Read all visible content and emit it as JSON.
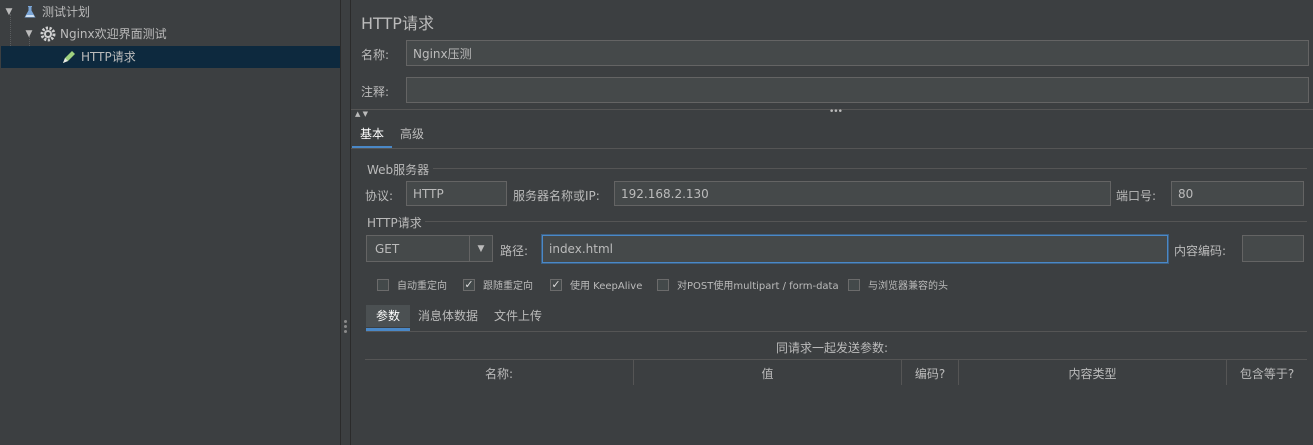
{
  "tree": {
    "items": [
      {
        "label": "测试计划",
        "icon": "flask-icon"
      },
      {
        "label": "Nginx欢迎界面测试",
        "icon": "gear-icon"
      },
      {
        "label": "HTTP请求",
        "icon": "pen-icon"
      }
    ]
  },
  "panel": {
    "title": "HTTP请求",
    "name_label": "名称:",
    "name_value": "Nginx压测",
    "comment_label": "注释:",
    "comment_value": "",
    "tabs": [
      "基本",
      "高级"
    ],
    "web_server": {
      "title": "Web服务器",
      "protocol_label": "协议:",
      "protocol_value": "HTTP",
      "server_label": "服务器名称或IP:",
      "server_value": "192.168.2.130",
      "port_label": "端口号:",
      "port_value": "80"
    },
    "http_request": {
      "title": "HTTP请求",
      "method": "GET",
      "path_label": "路径:",
      "path_value": "index.html",
      "encoding_label": "内容编码:",
      "encoding_value": ""
    },
    "checkboxes": [
      {
        "label": "自动重定向",
        "checked": false
      },
      {
        "label": "跟随重定向",
        "checked": true
      },
      {
        "label": "使用 KeepAlive",
        "checked": true
      },
      {
        "label": "对POST使用multipart / form-data",
        "checked": false
      },
      {
        "label": "与浏览器兼容的头",
        "checked": false
      }
    ],
    "subtabs": [
      "参数",
      "消息体数据",
      "文件上传"
    ],
    "params_caption": "同请求一起发送参数:",
    "table_headers": [
      "名称:",
      "值",
      "编码?",
      "内容类型",
      "包含等于?"
    ]
  },
  "colors": {
    "accent": "#4a88c7",
    "selection": "#0d293e",
    "background": "#3c3f41"
  }
}
